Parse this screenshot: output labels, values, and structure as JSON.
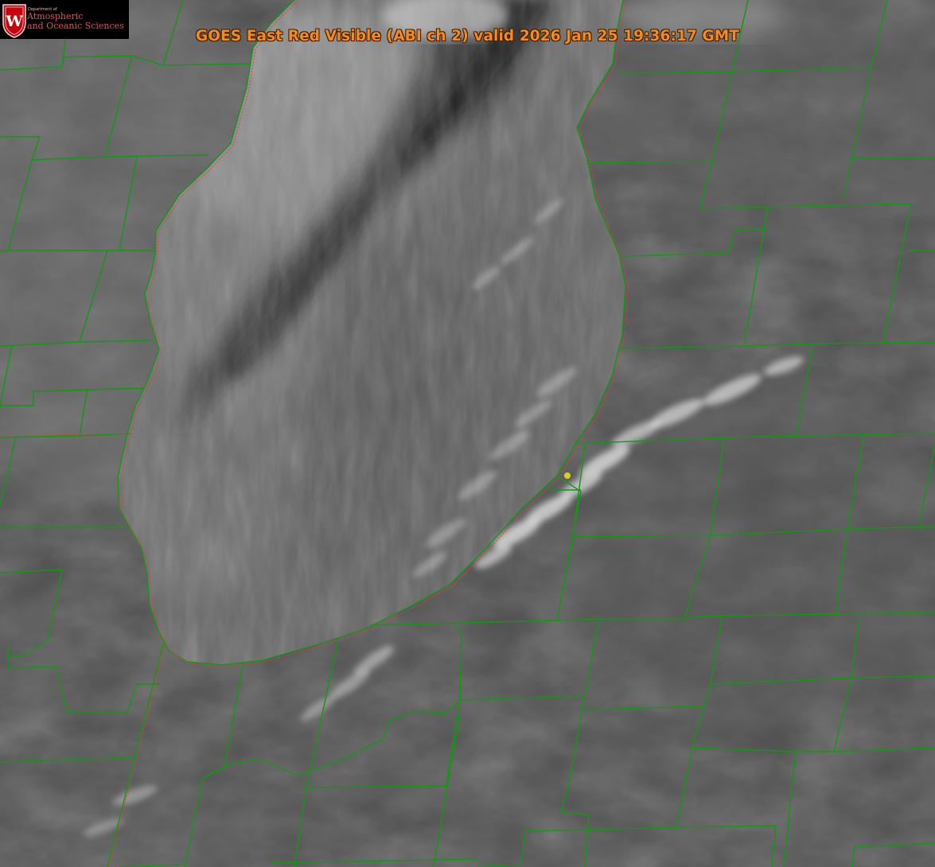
{
  "title": "GOES East Red Visible (ABI ch 2) valid 2026 Jan 25 19:36:17 GMT",
  "logo": {
    "department": "Department of",
    "line1": "Atmospheric",
    "line2": "and Oceanic Sciences",
    "seal_letter": "W"
  },
  "colors": {
    "county_borders": "#119911",
    "lake_shoreline": "#e03c3c",
    "marker": "#d8d020",
    "title_text": "#f58a1f",
    "logo_text": "#d3575f"
  },
  "layers": {
    "imagery": "grayscale visible satellite",
    "overlays": [
      "county-borders",
      "lake-shoreline",
      "point-marker"
    ]
  }
}
